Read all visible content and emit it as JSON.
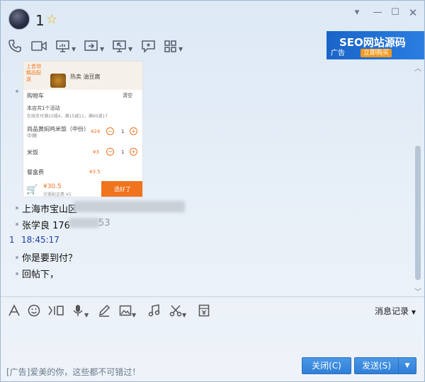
{
  "window": {
    "title": "1",
    "controls": [
      "minimize",
      "restore",
      "close"
    ]
  },
  "toolbar": {
    "icons": [
      "phone-icon",
      "video-icon",
      "screen-share-icon",
      "transfer-file-icon",
      "remote-assist-icon",
      "send-message-icon",
      "apps-icon"
    ]
  },
  "ad": {
    "title": "SEO网站源码",
    "tag": "广告",
    "button": "立即购买"
  },
  "screenshot": {
    "cart_title": "购物车",
    "clear": "清空",
    "promo_line1": "本店共1个活动",
    "promo_line2": "在线支付满10减4，满15减11，满60减17",
    "item1_name": "尚品黄焖鸡米饭（中份）",
    "item1_sub": "中辣",
    "item1_price": "¥24",
    "item1_qty": "1",
    "item2_name": "米饭",
    "item2_price": "¥3",
    "item2_qty": "1",
    "fee_name": "餐盒费",
    "fee_price": "¥3.5",
    "total": "¥30.5",
    "delivery": "另需配送费 ¥5",
    "checkout": "选好了",
    "top_label1": "上首领",
    "top_label2": "精品配",
    "top_label3": "送",
    "top_item": "热卖 油豆腐"
  },
  "messages": {
    "address": "上海市宝山区",
    "contact": "张学良 176",
    "contact_tail": "53",
    "time_sender": "1",
    "time": "18:45:17",
    "msg1": "你是要到付？",
    "msg2": "回帖下，"
  },
  "inputbar": {
    "icons": [
      "font-icon",
      "emoji-icon",
      "gif-icon",
      "voice-icon",
      "doodle-icon",
      "image-icon",
      "music-icon",
      "screenshot-icon",
      "red-packet-icon"
    ],
    "history": "消息记录"
  },
  "footer": {
    "ad_text": "[广告]爱美的你，这些都不可错过！",
    "close": "关闭(C)",
    "send": "发送(S)"
  }
}
